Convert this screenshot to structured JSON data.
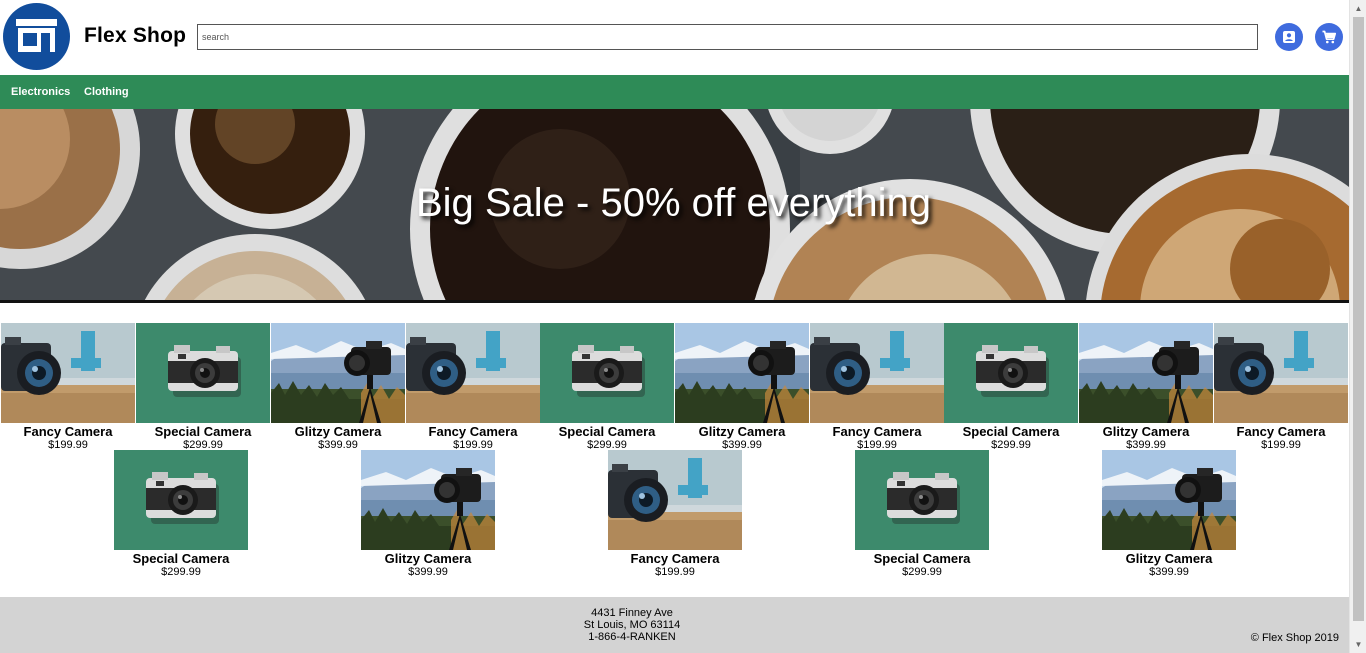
{
  "header": {
    "site_title": "Flex Shop",
    "search_placeholder": "search",
    "logo_icon": "storefront-icon",
    "account_icon": "account-icon",
    "cart_icon": "shopping-cart-icon"
  },
  "nav": {
    "items": [
      {
        "label": "Electronics"
      },
      {
        "label": "Clothing"
      }
    ]
  },
  "hero": {
    "text": "Big Sale - 50% off everything"
  },
  "products": {
    "row1": [
      {
        "name": "Fancy Camera",
        "price": "$199.99",
        "image": "fancy"
      },
      {
        "name": "Special Camera",
        "price": "$299.99",
        "image": "special"
      },
      {
        "name": "Glitzy Camera",
        "price": "$399.99",
        "image": "glitzy"
      },
      {
        "name": "Fancy Camera",
        "price": "$199.99",
        "image": "fancy"
      },
      {
        "name": "Special Camera",
        "price": "$299.99",
        "image": "special"
      },
      {
        "name": "Glitzy Camera",
        "price": "$399.99",
        "image": "glitzy"
      },
      {
        "name": "Fancy Camera",
        "price": "$199.99",
        "image": "fancy"
      },
      {
        "name": "Special Camera",
        "price": "$299.99",
        "image": "special"
      },
      {
        "name": "Glitzy Camera",
        "price": "$399.99",
        "image": "glitzy"
      },
      {
        "name": "Fancy Camera",
        "price": "$199.99",
        "image": "fancy"
      }
    ],
    "row2": [
      {
        "name": "Special Camera",
        "price": "$299.99",
        "image": "special"
      },
      {
        "name": "Glitzy Camera",
        "price": "$399.99",
        "image": "glitzy"
      },
      {
        "name": "Fancy Camera",
        "price": "$199.99",
        "image": "fancy"
      },
      {
        "name": "Special Camera",
        "price": "$299.99",
        "image": "special"
      },
      {
        "name": "Glitzy Camera",
        "price": "$399.99",
        "image": "glitzy"
      }
    ]
  },
  "footer": {
    "address_line1": "4431 Finney Ave",
    "address_line2": "St Louis, MO 63114",
    "phone": "1-866-4-RANKEN",
    "copyright": "© Flex Shop 2019"
  },
  "colors": {
    "nav_bg": "#2e8b57",
    "logo_bg": "#114d9c",
    "icon_button_bg": "#3f6bde",
    "footer_bg": "#d3d3d3",
    "special_camera_bg": "#3d8a6c"
  }
}
